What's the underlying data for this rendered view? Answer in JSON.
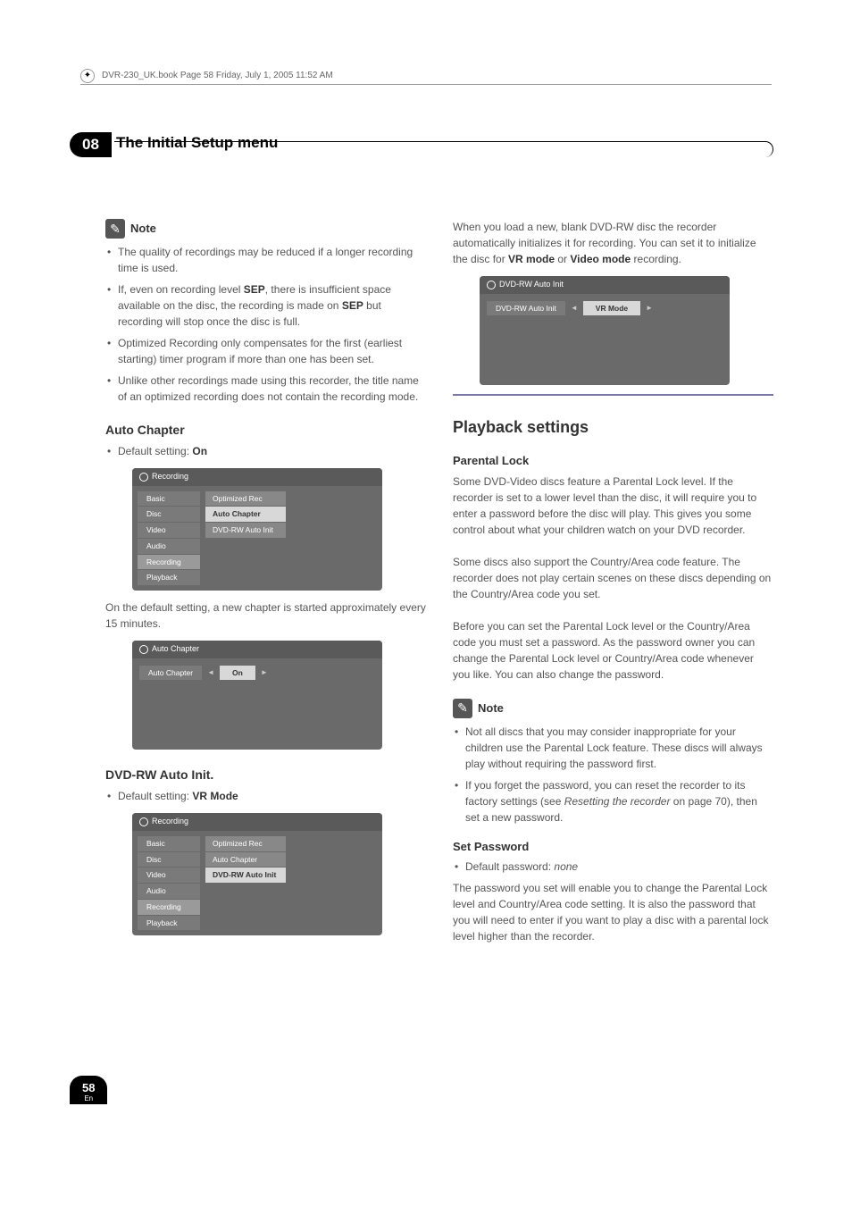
{
  "header": {
    "file_info": "DVR-230_UK.book  Page 58  Friday, July 1, 2005  11:52 AM"
  },
  "chapter": {
    "num": "08",
    "title": "The Initial Setup menu"
  },
  "notes": {
    "label": "Note",
    "left_items": [
      "The quality of recordings may be reduced if a longer recording time is used.",
      "If, even on recording level SEP, there is insufficient space available on the disc, the recording is made on SEP but recording will stop once the disc is full.",
      "Optimized Recording only compensates for the first (earliest starting) timer program if more than one has been set.",
      "Unlike other recordings made using this recorder, the title name of an optimized recording does not contain the recording mode."
    ],
    "right_items": [
      "Not all discs that you may consider inappropriate for your children use the Parental Lock feature. These discs will always play without requiring the password first.",
      "If you forget the password, you can reset the recorder to its factory settings (see Resetting the recorder on page 70), then set a new password."
    ]
  },
  "auto_chapter": {
    "heading": "Auto Chapter",
    "default": "Default setting: ",
    "default_val": "On",
    "desc": "On the default setting, a new chapter is started approximately every 15 minutes."
  },
  "dvd_rw": {
    "heading": "DVD-RW Auto Init.",
    "default": "Default setting: ",
    "default_val": "VR Mode"
  },
  "right_intro": "When you load a new, blank DVD-RW disc the recorder automatically initializes it for recording. You can set it to initialize the disc for VR mode or Video mode recording.",
  "playback": {
    "heading": "Playback settings",
    "parental_h": "Parental Lock",
    "p1": "Some DVD-Video discs feature a Parental Lock level. If the recorder is set to a lower level than the disc, it will require you to enter a password before the disc will play. This gives you some control about what your children watch on your DVD recorder.",
    "p2": "Some discs also support the Country/Area code feature. The recorder does not play certain scenes on these discs depending on the Country/Area code you set.",
    "p3": "Before you can set the Parental Lock level or the Country/Area code you must set a password. As the password owner you can change the Parental Lock level or Country/Area code whenever you like. You can also change the password."
  },
  "set_pw": {
    "heading": "Set Password",
    "default": "Default password: ",
    "default_val": "none",
    "desc": "The password you set will enable you to change the Parental Lock level and Country/Area code setting. It is also the password that you will need to enter if you want to play a disc with a parental lock level higher than the recorder."
  },
  "menu1": {
    "title": "Recording",
    "left": [
      "Basic",
      "Disc",
      "Video",
      "Audio",
      "Recording",
      "Playback"
    ],
    "right": [
      "Optimized Rec",
      "Auto Chapter",
      "DVD-RW Auto Init"
    ]
  },
  "menu2": {
    "title": "Auto Chapter",
    "label": "Auto Chapter",
    "value": "On"
  },
  "menu3": {
    "title": "DVD-RW Auto Init",
    "label": "DVD-RW Auto Init",
    "value": "VR Mode"
  },
  "page": {
    "num": "58",
    "lang": "En"
  }
}
